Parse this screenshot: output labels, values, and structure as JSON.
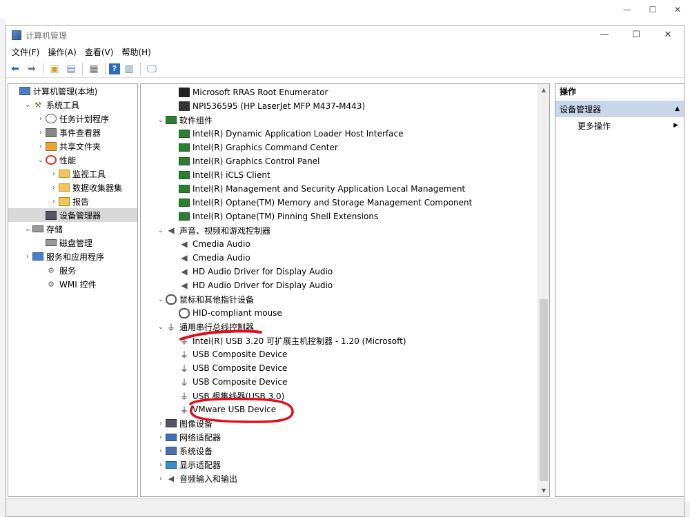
{
  "window": {
    "title": "计算机管理",
    "controls": {
      "minimize": "—",
      "maximize": "☐",
      "close": "✕"
    }
  },
  "background_window": {
    "minimize": "—",
    "maximize": "☐",
    "close": "✕"
  },
  "menu": [
    "文件(F)",
    "操作(A)",
    "查看(V)",
    "帮助(H)"
  ],
  "toolbar": [
    "back-arrow-icon",
    "forward-arrow-icon",
    "up-folder-icon",
    "show-hide-tree-icon",
    "properties-icon",
    "help-icon",
    "show-hide-action-pane-icon",
    "monitor-icon"
  ],
  "tree": [
    {
      "label": "计算机管理(本地)",
      "level": 0,
      "expander": "",
      "icon": "computer-management-icon"
    },
    {
      "label": "系统工具",
      "level": 1,
      "expander": "⌄",
      "icon": "tools-icon"
    },
    {
      "label": "任务计划程序",
      "level": 2,
      "expander": "›",
      "icon": "task-scheduler-icon"
    },
    {
      "label": "事件查看器",
      "level": 2,
      "expander": "›",
      "icon": "event-viewer-icon"
    },
    {
      "label": "共享文件夹",
      "level": 2,
      "expander": "›",
      "icon": "shared-folders-icon"
    },
    {
      "label": "性能",
      "level": 2,
      "expander": "⌄",
      "icon": "performance-icon"
    },
    {
      "label": "监视工具",
      "level": 3,
      "expander": "›",
      "icon": "monitoring-tools-icon"
    },
    {
      "label": "数据收集器集",
      "level": 3,
      "expander": "›",
      "icon": "data-collector-sets-icon"
    },
    {
      "label": "报告",
      "level": 3,
      "expander": "›",
      "icon": "reports-icon"
    },
    {
      "label": "设备管理器",
      "level": 2,
      "expander": "",
      "icon": "device-manager-icon",
      "selected": true
    },
    {
      "label": "存储",
      "level": 1,
      "expander": "⌄",
      "icon": "storage-icon"
    },
    {
      "label": "磁盘管理",
      "level": 2,
      "expander": "",
      "icon": "disk-management-icon"
    },
    {
      "label": "服务和应用程序",
      "level": 1,
      "expander": "›",
      "icon": "services-apps-icon"
    },
    {
      "label": "服务",
      "level": 2,
      "expander": "",
      "icon": "services-icon"
    },
    {
      "label": "WMI 控件",
      "level": 2,
      "expander": "",
      "icon": "wmi-control-icon"
    }
  ],
  "devices": [
    {
      "label": "Microsoft RRAS Root Enumerator",
      "level": 1,
      "expander": "",
      "icon": "device-chip-icon"
    },
    {
      "label": "NPI536595 (HP LaserJet MFP M437-M443)",
      "level": 1,
      "expander": "",
      "icon": "device-printer-icon"
    },
    {
      "label": "软件组件",
      "level": 0,
      "expander": "⌄",
      "icon": "software-components-icon"
    },
    {
      "label": "Intel(R) Dynamic Application Loader Host Interface",
      "level": 1,
      "expander": "",
      "icon": "software-component-icon"
    },
    {
      "label": "Intel(R) Graphics Command Center",
      "level": 1,
      "expander": "",
      "icon": "software-component-icon"
    },
    {
      "label": "Intel(R) Graphics Control Panel",
      "level": 1,
      "expander": "",
      "icon": "software-component-icon"
    },
    {
      "label": "Intel(R) iCLS Client",
      "level": 1,
      "expander": "",
      "icon": "software-component-icon"
    },
    {
      "label": "Intel(R) Management and Security Application Local Management",
      "level": 1,
      "expander": "",
      "icon": "software-component-icon"
    },
    {
      "label": "Intel(R) Optane(TM) Memory and Storage Management Component",
      "level": 1,
      "expander": "",
      "icon": "software-component-icon"
    },
    {
      "label": "Intel(R) Optane(TM) Pinning Shell Extensions",
      "level": 1,
      "expander": "",
      "icon": "software-component-icon"
    },
    {
      "label": "声音、视频和游戏控制器",
      "level": 0,
      "expander": "⌄",
      "icon": "sound-video-icon"
    },
    {
      "label": "Cmedia Audio",
      "level": 1,
      "expander": "",
      "icon": "speaker-icon"
    },
    {
      "label": "Cmedia Audio",
      "level": 1,
      "expander": "",
      "icon": "speaker-icon"
    },
    {
      "label": "HD Audio Driver for Display Audio",
      "level": 1,
      "expander": "",
      "icon": "speaker-icon"
    },
    {
      "label": "HD Audio Driver for Display Audio",
      "level": 1,
      "expander": "",
      "icon": "speaker-icon"
    },
    {
      "label": "鼠标和其他指针设备",
      "level": 0,
      "expander": "⌄",
      "icon": "mouse-category-icon"
    },
    {
      "label": "HID-compliant mouse",
      "level": 1,
      "expander": "",
      "icon": "mouse-icon"
    },
    {
      "label": "通用串行总线控制器",
      "level": 0,
      "expander": "⌄",
      "icon": "usb-controllers-icon"
    },
    {
      "label": "Intel(R) USB 3.20 可扩展主机控制器 - 1.20 (Microsoft)",
      "level": 1,
      "expander": "",
      "icon": "usb-icon"
    },
    {
      "label": "USB Composite Device",
      "level": 1,
      "expander": "",
      "icon": "usb-icon"
    },
    {
      "label": "USB Composite Device",
      "level": 1,
      "expander": "",
      "icon": "usb-icon"
    },
    {
      "label": "USB Composite Device",
      "level": 1,
      "expander": "",
      "icon": "usb-icon"
    },
    {
      "label": "USB 根集线器(USB 3.0)",
      "level": 1,
      "expander": "",
      "icon": "usb-icon"
    },
    {
      "label": "VMware USB Device",
      "level": 1,
      "expander": "",
      "icon": "usb-icon"
    },
    {
      "label": "图像设备",
      "level": 0,
      "expander": "›",
      "icon": "imaging-devices-icon"
    },
    {
      "label": "网络适配器",
      "level": 0,
      "expander": "›",
      "icon": "network-adapters-icon"
    },
    {
      "label": "系统设备",
      "level": 0,
      "expander": "›",
      "icon": "system-devices-icon"
    },
    {
      "label": "显示适配器",
      "level": 0,
      "expander": "›",
      "icon": "display-adapters-icon"
    },
    {
      "label": "音频输入和输出",
      "level": 0,
      "expander": "›",
      "icon": "audio-io-icon"
    }
  ],
  "actions": {
    "header": "操作",
    "section": "设备管理器",
    "section_arrow": "▲",
    "more": "更多操作",
    "more_arrow": "▶"
  },
  "colors": {
    "annotation": "#e0101a",
    "selection": "#d9d9d9",
    "actions_section_bg": "#c9d7ea"
  }
}
